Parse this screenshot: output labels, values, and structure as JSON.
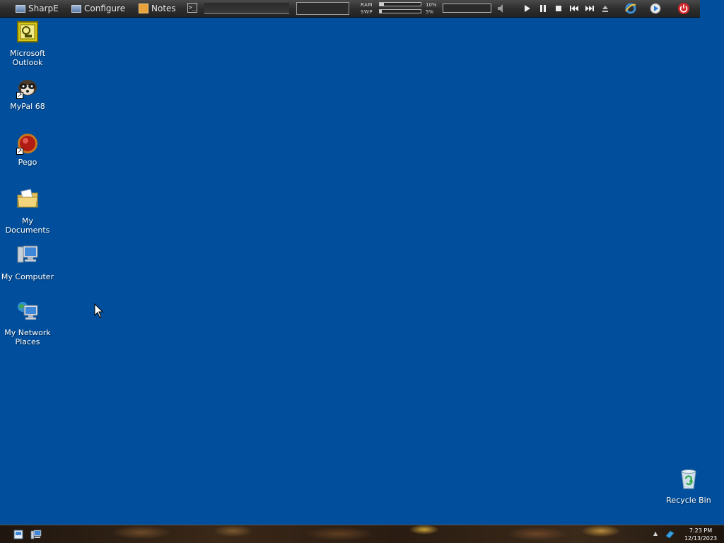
{
  "topbar": {
    "sharpe_label": "SharpE",
    "configure_label": "Configure",
    "notes_label": "Notes",
    "ram_label": "RAM",
    "swp_label": "SWP",
    "ram_value": "10%",
    "swp_value": "5%",
    "ram_fraction": 0.1,
    "swp_fraction": 0.05
  },
  "desktop_icons": [
    {
      "label": "Microsoft Outlook",
      "icon": "outlook-icon"
    },
    {
      "label": "MyPal 68",
      "icon": "mypal-icon"
    },
    {
      "label": "Pego",
      "icon": "pego-icon"
    },
    {
      "label": "My Documents",
      "icon": "folder-icon"
    },
    {
      "label": "My Computer",
      "icon": "computer-icon"
    },
    {
      "label": "My Network Places",
      "icon": "network-icon"
    },
    {
      "label": "Recycle Bin",
      "icon": "recycle-bin-icon"
    }
  ],
  "taskbar": {
    "time": "7:23 PM",
    "date": "12/13/2023"
  },
  "colors": {
    "desktop_background": "#014f9c",
    "bar_background": "#2e2e2e"
  }
}
